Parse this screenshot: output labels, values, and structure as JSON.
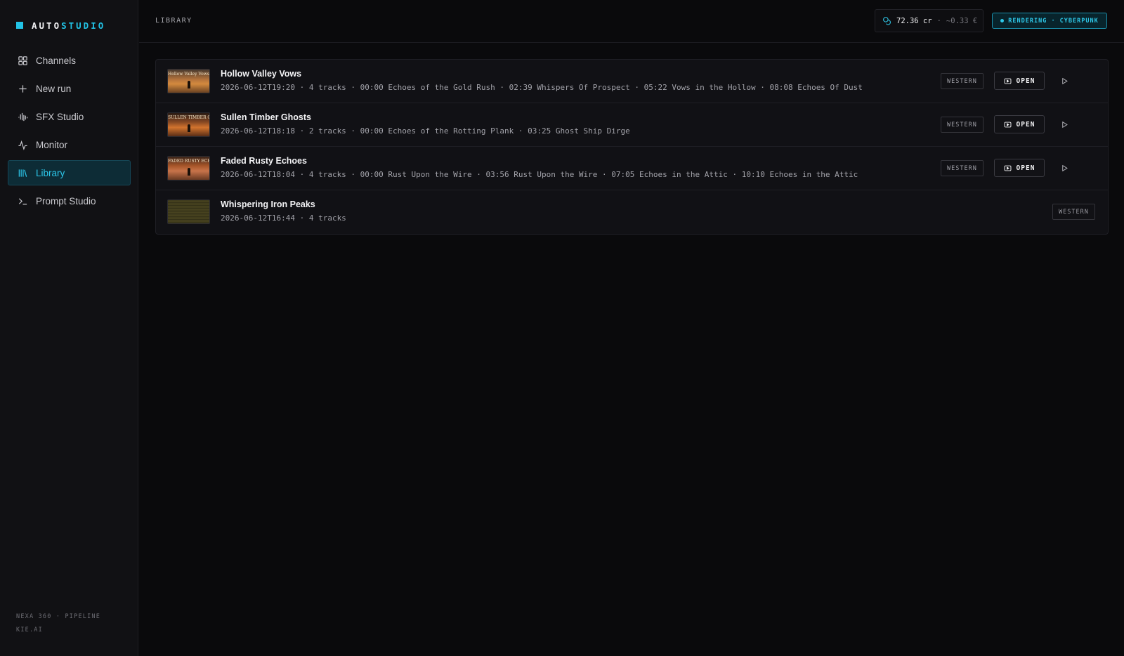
{
  "app": {
    "logo_part1": "AUTO",
    "logo_part2": "STUDIO"
  },
  "sidebar": {
    "items": [
      {
        "label": "Channels",
        "icon": "grid-icon"
      },
      {
        "label": "New run",
        "icon": "plus-icon"
      },
      {
        "label": "SFX Studio",
        "icon": "waveform-icon"
      },
      {
        "label": "Monitor",
        "icon": "activity-icon"
      },
      {
        "label": "Library",
        "icon": "library-icon",
        "active": true
      },
      {
        "label": "Prompt Studio",
        "icon": "terminal-icon"
      }
    ],
    "footer_line1": "NEXA 360 · PIPELINE",
    "footer_line2": "KIE.AI"
  },
  "header": {
    "breadcrumb": "LIBRARY",
    "credits_value": "72.36 cr",
    "credits_sep": "·",
    "credits_eur": "~0.33 €",
    "render_status": "RENDERING · CYBERPUNK"
  },
  "library": {
    "open_label": "OPEN",
    "rows": [
      {
        "title": "Hollow Valley Vows",
        "thumb_text": "Hollow Valley Vows",
        "meta": "2026-06-12T19:20 · 4 tracks · 00:00 Echoes of the Gold Rush · 02:39 Whispers Of Prospect · 05:22 Vows in the Hollow · 08:08 Echoes Of Dust",
        "tag": "WESTERN",
        "has_actions": true
      },
      {
        "title": "Sullen Timber Ghosts",
        "thumb_text": "SULLEN TIMBER GHOSTS",
        "meta": "2026-06-12T18:18 · 2 tracks · 00:00 Echoes of the Rotting Plank · 03:25 Ghost Ship Dirge",
        "tag": "WESTERN",
        "has_actions": true
      },
      {
        "title": "Faded Rusty Echoes",
        "thumb_text": "FADED RUSTY ECHOES",
        "meta": "2026-06-12T18:04 · 4 tracks · 00:00 Rust Upon the Wire · 03:56 Rust Upon the Wire · 07:05 Echoes in the Attic · 10:10 Echoes in the Attic",
        "tag": "WESTERN",
        "has_actions": true
      },
      {
        "title": "Whispering Iron Peaks",
        "thumb_text": "",
        "meta": "2026-06-12T16:44 · 4 tracks",
        "tag": "WESTERN",
        "has_actions": false
      }
    ]
  },
  "colors": {
    "accent": "#22c3e6",
    "background": "#0a0a0c",
    "sidebar": "#111114"
  }
}
